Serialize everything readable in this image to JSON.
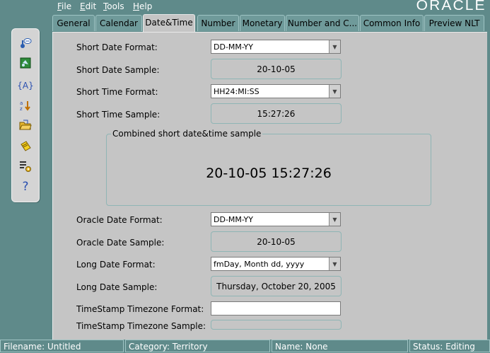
{
  "menu": {
    "file": {
      "mnemonic": "F",
      "rest": "ile"
    },
    "edit": {
      "mnemonic": "E",
      "rest": "dit"
    },
    "tools": {
      "mnemonic": "T",
      "rest": "ools"
    },
    "help": {
      "mnemonic": "H",
      "rest": "elp"
    }
  },
  "brand": "ORACLE",
  "tabs": [
    "General",
    "Calendar",
    "Date&Time",
    "Number",
    "Monetary",
    "Number and C...",
    "Common Info",
    "Preview NLT"
  ],
  "active_tab": "Date&Time",
  "toolbar_icons": [
    "wizard-icon",
    "green-book-icon",
    "variable-braces-icon",
    "sort-icon",
    "open-folder-icon",
    "yellow-note-icon",
    "properties-icon",
    "help-icon"
  ],
  "form": {
    "short_date_format": {
      "label": "Short Date Format:",
      "value": "DD-MM-YY"
    },
    "short_date_sample": {
      "label": "Short Date Sample:",
      "value": "20-10-05"
    },
    "short_time_format": {
      "label": "Short Time Format:",
      "value": "HH24:MI:SS"
    },
    "short_time_sample": {
      "label": "Short Time Sample:",
      "value": "15:27:26"
    },
    "combined": {
      "title": "Combined short date&time sample",
      "value": "20-10-05 15:27:26"
    },
    "oracle_date_format": {
      "label": "Oracle Date Format:",
      "value": "DD-MM-YY"
    },
    "oracle_date_sample": {
      "label": "Oracle Date Sample:",
      "value": "20-10-05"
    },
    "long_date_format": {
      "label": "Long Date Format:",
      "value": "fmDay, Month dd, yyyy"
    },
    "long_date_sample": {
      "label": "Long Date Sample:",
      "value": "Thursday, October 20, 2005"
    },
    "timestamp_tz_format": {
      "label": "TimeStamp Timezone Format:",
      "value": ""
    },
    "timestamp_tz_sample": {
      "label": "TimeStamp Timezone Sample:",
      "value": ""
    }
  },
  "status": {
    "filename": "Filename: Untitled",
    "category": "Category: Territory",
    "name": "Name: None",
    "state": "Status: Editing"
  },
  "colors": {
    "background": "#5f8a8a",
    "panel": "#c5c5c5",
    "border_accent": "#8fb5b5"
  }
}
